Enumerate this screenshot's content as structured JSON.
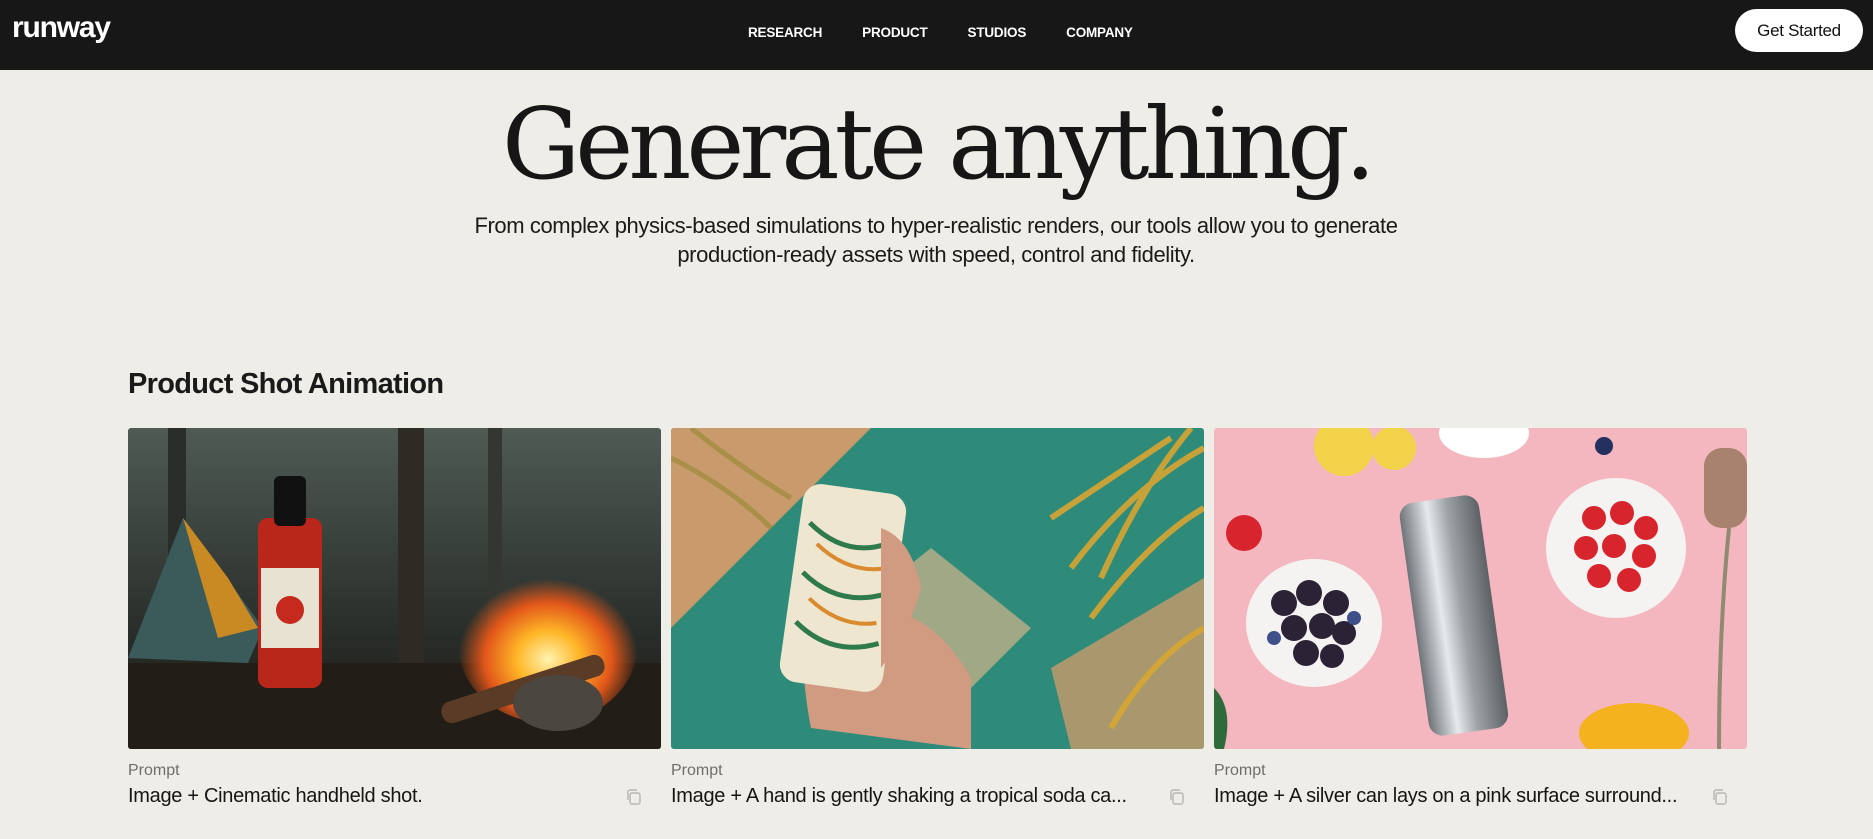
{
  "brand": {
    "logo": "runway"
  },
  "nav": {
    "items": [
      "RESEARCH",
      "PRODUCT",
      "STUDIOS",
      "COMPANY"
    ],
    "cta_label": "Get Started"
  },
  "hero": {
    "title": "Generate anything.",
    "subtitle_line1": "From complex physics-based simulations to hyper-realistic renders, our tools allow you to generate",
    "subtitle_line2": "production-ready assets with speed, control and fidelity."
  },
  "section": {
    "title": "Product Shot Animation",
    "cards": [
      {
        "label": "Prompt",
        "prompt": "Image + Cinematic handheld shot.",
        "image": "hot-sauce-campfire-image",
        "copy_icon": "copy-icon"
      },
      {
        "label": "Prompt",
        "prompt": "Image + A hand is gently shaking a tropical soda ca...",
        "image": "tropical-soda-can-image",
        "copy_icon": "copy-icon"
      },
      {
        "label": "Prompt",
        "prompt": "Image + A silver can lays on a pink surface surround...",
        "image": "silver-can-berries-image",
        "copy_icon": "copy-icon"
      }
    ]
  },
  "colors": {
    "nav_bg": "#171717",
    "page_bg": "#efede7",
    "cta_bg": "#ffffff"
  }
}
